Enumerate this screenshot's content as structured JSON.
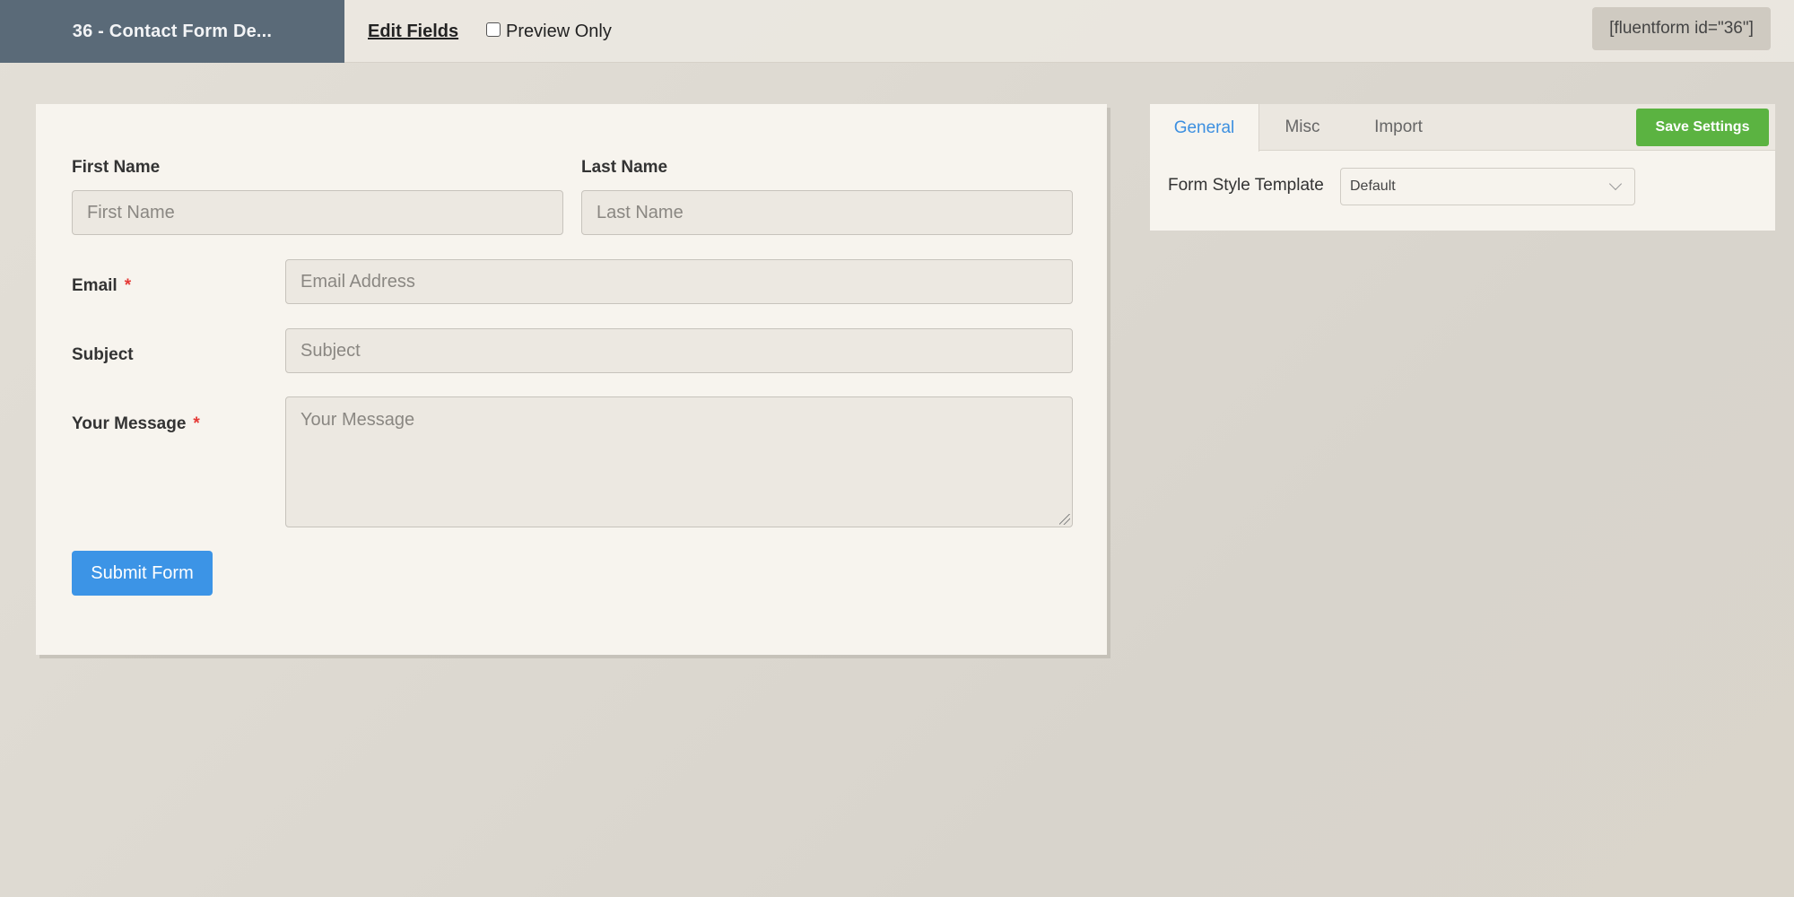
{
  "header": {
    "form_title": "36 - Contact Form De...",
    "edit_fields_label": "Edit Fields",
    "preview_only_label": "Preview Only",
    "shortcode": "[fluentform id=\"36\"]"
  },
  "form": {
    "first_name": {
      "label": "First Name",
      "placeholder": "First Name"
    },
    "last_name": {
      "label": "Last Name",
      "placeholder": "Last Name"
    },
    "email": {
      "label": "Email",
      "placeholder": "Email Address",
      "required_mark": "*"
    },
    "subject": {
      "label": "Subject",
      "placeholder": "Subject"
    },
    "message": {
      "label": "Your Message",
      "placeholder": "Your Message",
      "required_mark": "*"
    },
    "submit_label": "Submit Form"
  },
  "settings": {
    "tabs": [
      {
        "label": "General",
        "active": true
      },
      {
        "label": "Misc",
        "active": false
      },
      {
        "label": "Import",
        "active": false
      }
    ],
    "save_label": "Save Settings",
    "style_template_label": "Form Style Template",
    "style_template_value": "Default"
  },
  "colors": {
    "title_bg": "#5a6a78",
    "submit_blue": "#3c94e6",
    "save_green": "#5bb341",
    "active_tab": "#3c8fe0",
    "required_red": "#e53935"
  }
}
